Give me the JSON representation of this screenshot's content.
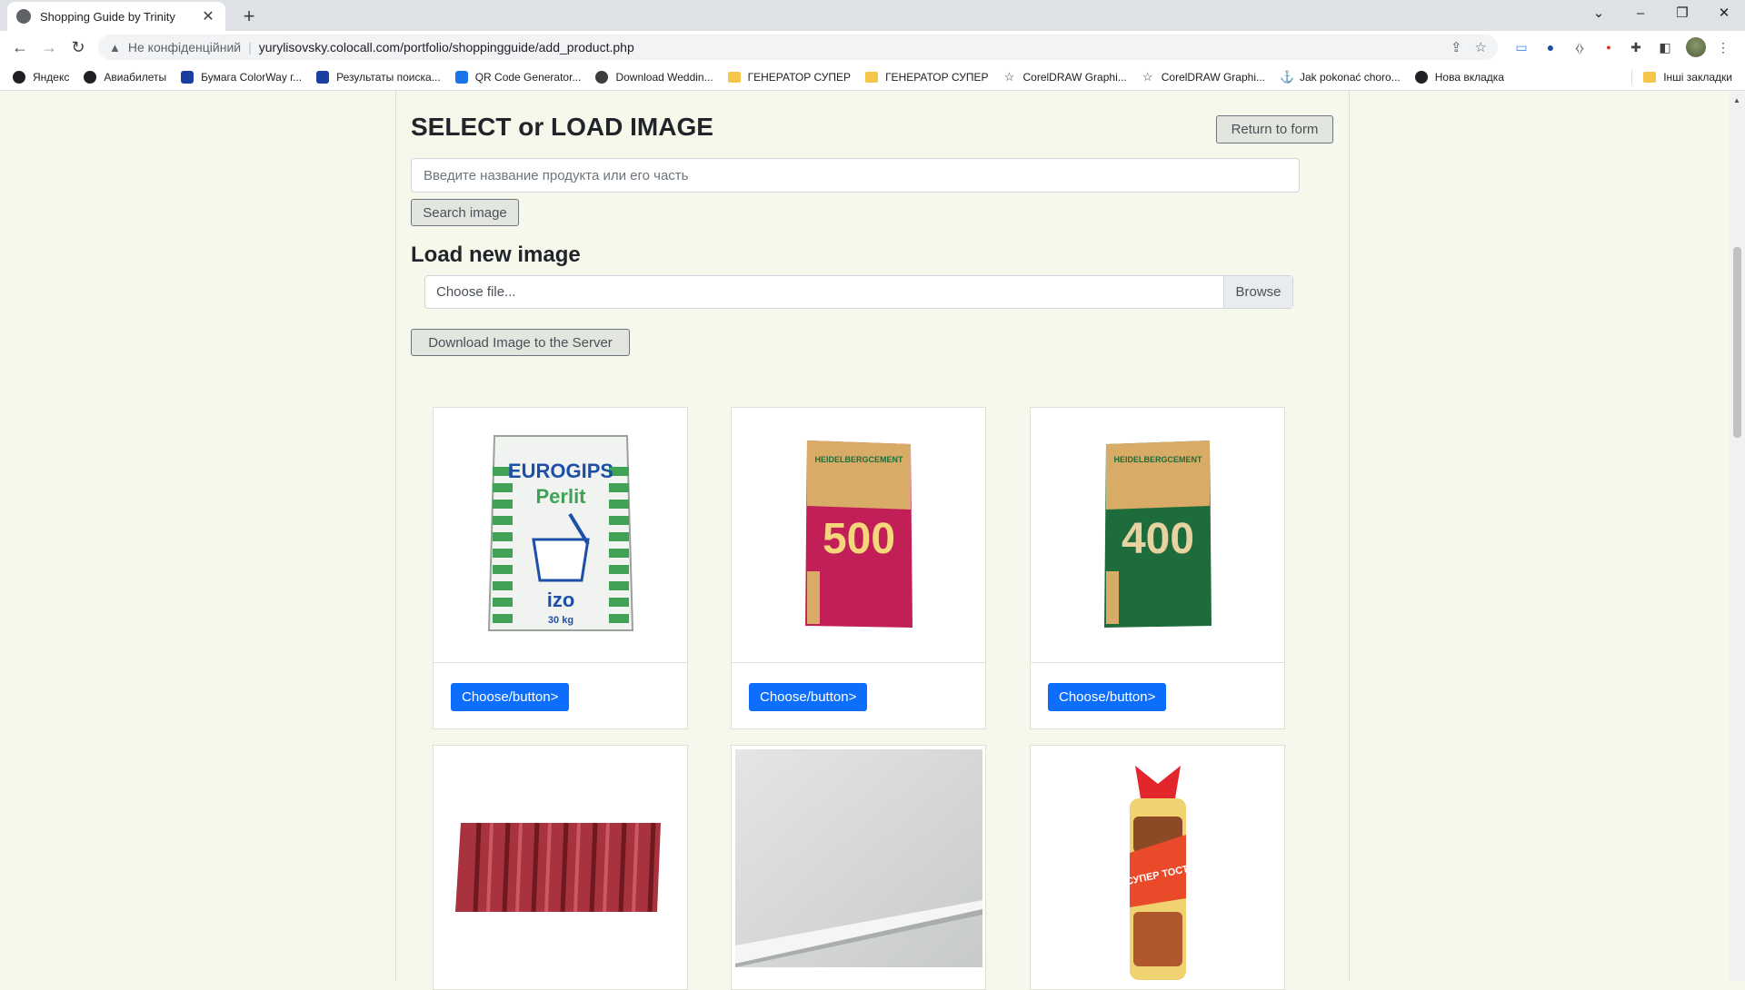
{
  "browser": {
    "tab_title": "Shopping Guide by Trinity",
    "not_secure_label": "Не конфіденційний",
    "url": "yurylisovsky.colocall.com/portfolio/shoppingguide/add_product.php",
    "bookmarks": [
      {
        "label": "Яндекс",
        "icon": "yandex-icon"
      },
      {
        "label": "Авиабилеты",
        "icon": "plane-icon"
      },
      {
        "label": "Бумага ColorWay г...",
        "icon": "colorway-icon"
      },
      {
        "label": "Результаты поиска...",
        "icon": "colorway-icon"
      },
      {
        "label": "QR Code Generator...",
        "icon": "qr-icon"
      },
      {
        "label": "Download Weddin...",
        "icon": "download-icon"
      },
      {
        "label": "ГЕНЕРАТОР СУПЕР",
        "icon": "folder-icon"
      },
      {
        "label": "ГЕНЕРАТОР СУПЕР",
        "icon": "folder-icon"
      },
      {
        "label": "CorelDRAW Graphi...",
        "icon": "star-icon"
      },
      {
        "label": "CorelDRAW Graphi...",
        "icon": "star-icon"
      },
      {
        "label": "Jak pokonać choro...",
        "icon": "anchor-icon"
      },
      {
        "label": "Нова вкладка",
        "icon": "globe-icon"
      }
    ],
    "other_bookmarks": "Інші закладки"
  },
  "page": {
    "title": "SELECT or LOAD IMAGE",
    "return_button": "Return to form",
    "search_placeholder": "Введите название продукта или его часть",
    "search_button": "Search image",
    "load_heading": "Load new image",
    "file_placeholder": "Choose file...",
    "browse_label": "Browse",
    "upload_button": "Download Image to the Server",
    "products": [
      {
        "name": "eurogips-perlit-bag",
        "brand": "EUROGIPS",
        "label": "Perlit",
        "sub": "izo",
        "weight": "30 kg",
        "choose": "Choose/button>"
      },
      {
        "name": "heidelberg-cement-500",
        "brand": "HEIDELBERGCEMENT",
        "label": "500",
        "choose": "Choose/button>"
      },
      {
        "name": "heidelberg-cement-400",
        "brand": "HEIDELBERGCEMENT",
        "label": "400",
        "choose": "Choose/button>"
      },
      {
        "name": "metal-roof-sheet"
      },
      {
        "name": "drywall-sheet"
      },
      {
        "name": "super-toast-bread",
        "label": "СУПЕР ТОСТ"
      }
    ]
  },
  "colors": {
    "page_bg": "#f7f8ec",
    "primary": "#0d6efd"
  }
}
